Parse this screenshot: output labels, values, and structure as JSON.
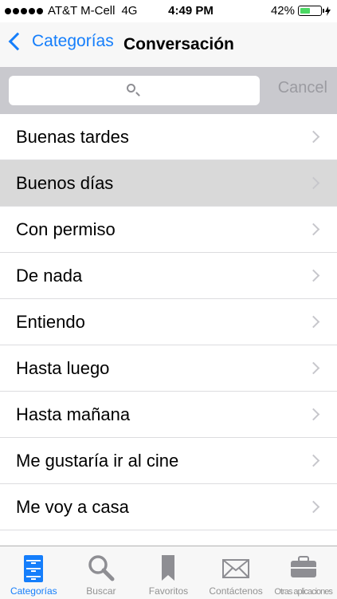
{
  "status": {
    "carrier": "AT&T M-Cell",
    "network": "4G",
    "time": "4:49 PM",
    "battery": "42%",
    "battery_level": 0.42
  },
  "nav": {
    "back_label": "Categorías",
    "title": "Conversación"
  },
  "search": {
    "value": "",
    "cancel_label": "Cancel"
  },
  "list": [
    {
      "label": "Buenas tardes"
    },
    {
      "label": "Buenos días"
    },
    {
      "label": "Con permiso"
    },
    {
      "label": "De nada"
    },
    {
      "label": "Entiendo"
    },
    {
      "label": "Hasta luego"
    },
    {
      "label": "Hasta mañana"
    },
    {
      "label": "Me gustaría ir al cine"
    },
    {
      "label": "Me voy a casa"
    }
  ],
  "selected_item": "Buenos días",
  "tabs": [
    {
      "label": "Categorías",
      "icon": "categories-icon",
      "active": true
    },
    {
      "label": "Buscar",
      "icon": "search-icon"
    },
    {
      "label": "Favoritos",
      "icon": "bookmark-icon"
    },
    {
      "label": "Contáctenos",
      "icon": "envelope-icon"
    },
    {
      "label": "Otras aplicaciones",
      "icon": "briefcase-icon"
    }
  ],
  "colors": {
    "accent": "#157efb",
    "inactive": "#929292",
    "battery_fill": "#4cd964"
  }
}
